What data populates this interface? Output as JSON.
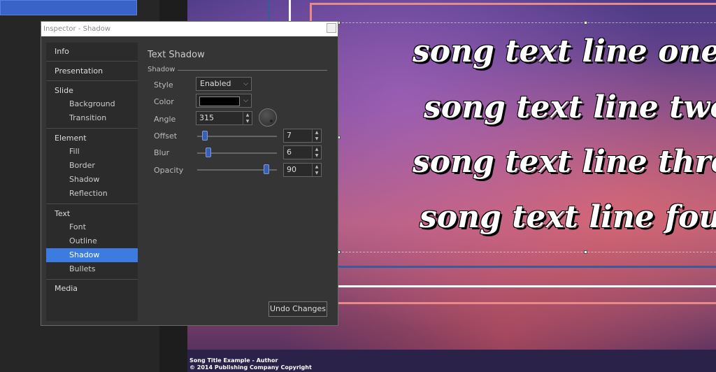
{
  "inspector": {
    "title": "Inspector - Shadow",
    "nav": {
      "info": "Info",
      "presentation": "Presentation",
      "slide": "Slide",
      "slide_items": [
        "Background",
        "Transition"
      ],
      "element": "Element",
      "element_items": [
        "Fill",
        "Border",
        "Shadow",
        "Reflection"
      ],
      "text": "Text",
      "text_items": [
        "Font",
        "Outline",
        "Shadow",
        "Bullets"
      ],
      "media": "Media",
      "active_item": "Shadow"
    },
    "panel": {
      "title": "Text Shadow",
      "section": "Shadow",
      "style_label": "Style",
      "style_value": "Enabled",
      "color_label": "Color",
      "color_value": "#000000",
      "angle_label": "Angle",
      "angle_value": "315",
      "offset_label": "Offset",
      "offset_value": "7",
      "blur_label": "Blur",
      "blur_value": "6",
      "opacity_label": "Opacity",
      "opacity_value": "90",
      "undo_label": "Undo Changes"
    }
  },
  "slide": {
    "lines": [
      "song text line one",
      "song text line two",
      "song text line three",
      "song text line four"
    ],
    "footer_line1": "Song Title Example - Author",
    "footer_line2": "© 2014 Publishing Company Copyright"
  },
  "colors": {
    "accent": "#3c7be0",
    "slider_thumb": "#3a5fb0"
  }
}
